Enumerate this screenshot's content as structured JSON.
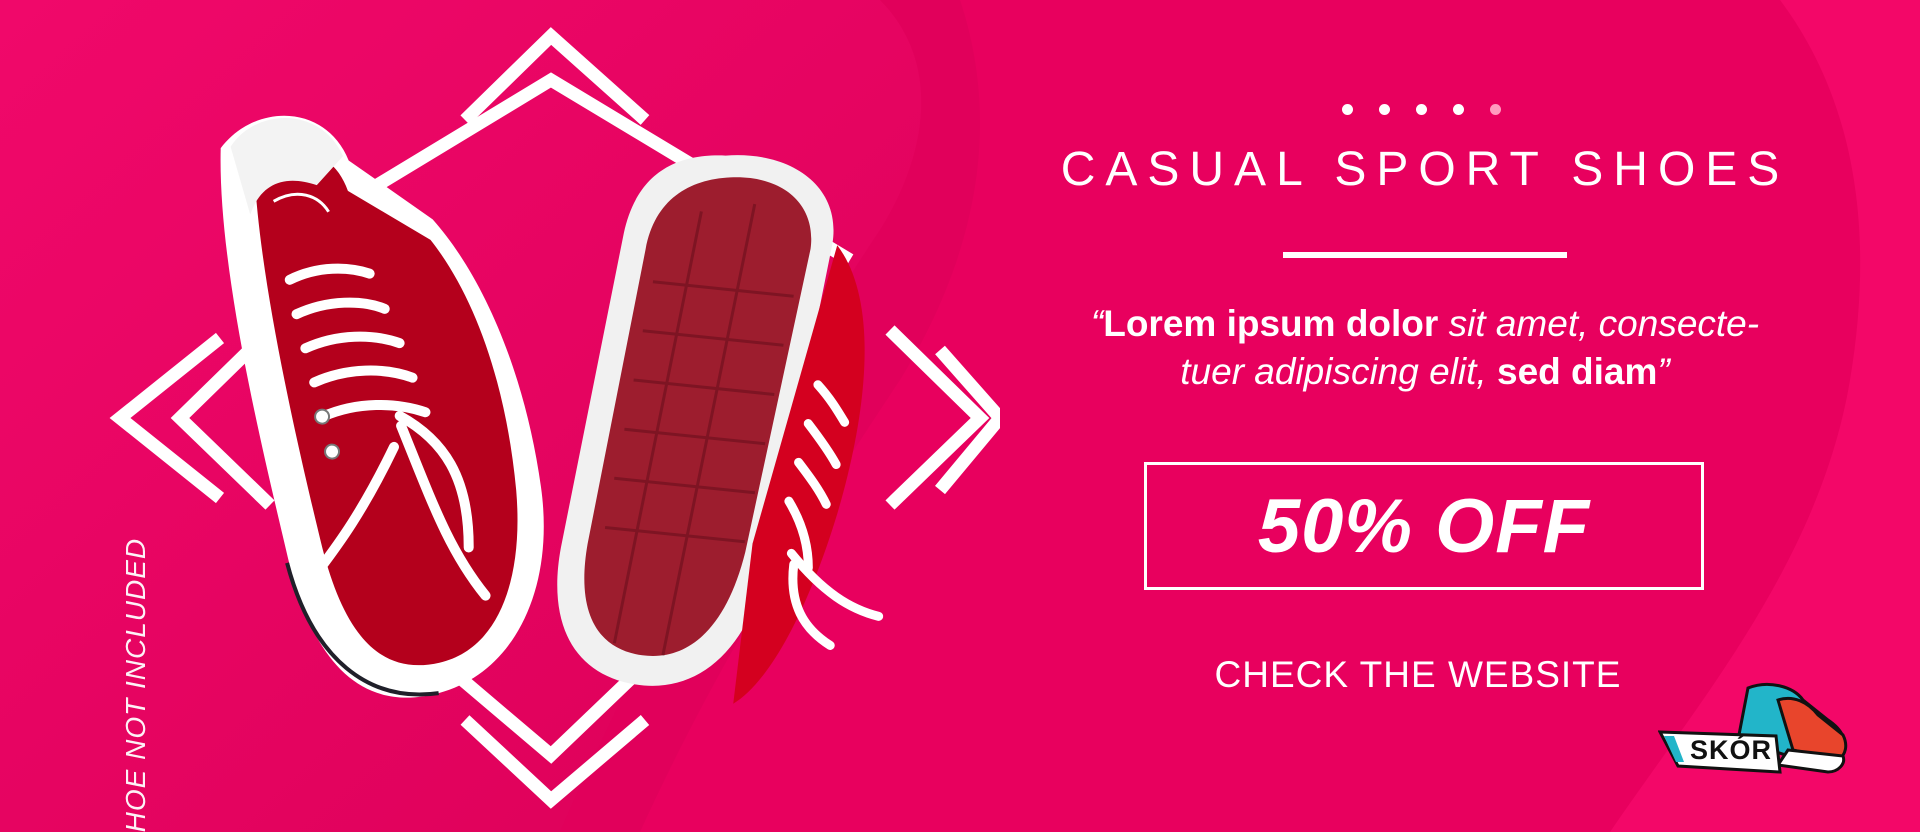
{
  "colors": {
    "background": "#e8005e",
    "accent_light": "#ff1a70",
    "text": "#ffffff"
  },
  "promo": {
    "headline": "CASUAL SPORT SHOES",
    "quote": {
      "open_mark": "“",
      "bold_1": "Lorem ipsum dolor",
      "italic_1": " sit amet, consecte-",
      "italic_2": "tuer adipiscing elit,",
      "bold_2": " sed diam",
      "close_mark": "”"
    },
    "offer": "50% OFF",
    "cta": "CHECK THE WEBSITE",
    "disclaimer": "SHOE NOT INCLUDED",
    "slider_dots": 5
  },
  "brand": {
    "logo_text": "SKÓR",
    "logo_icon": "sneaker-logo-icon"
  },
  "product_image": "pair-of-red-canvas-sneakers"
}
